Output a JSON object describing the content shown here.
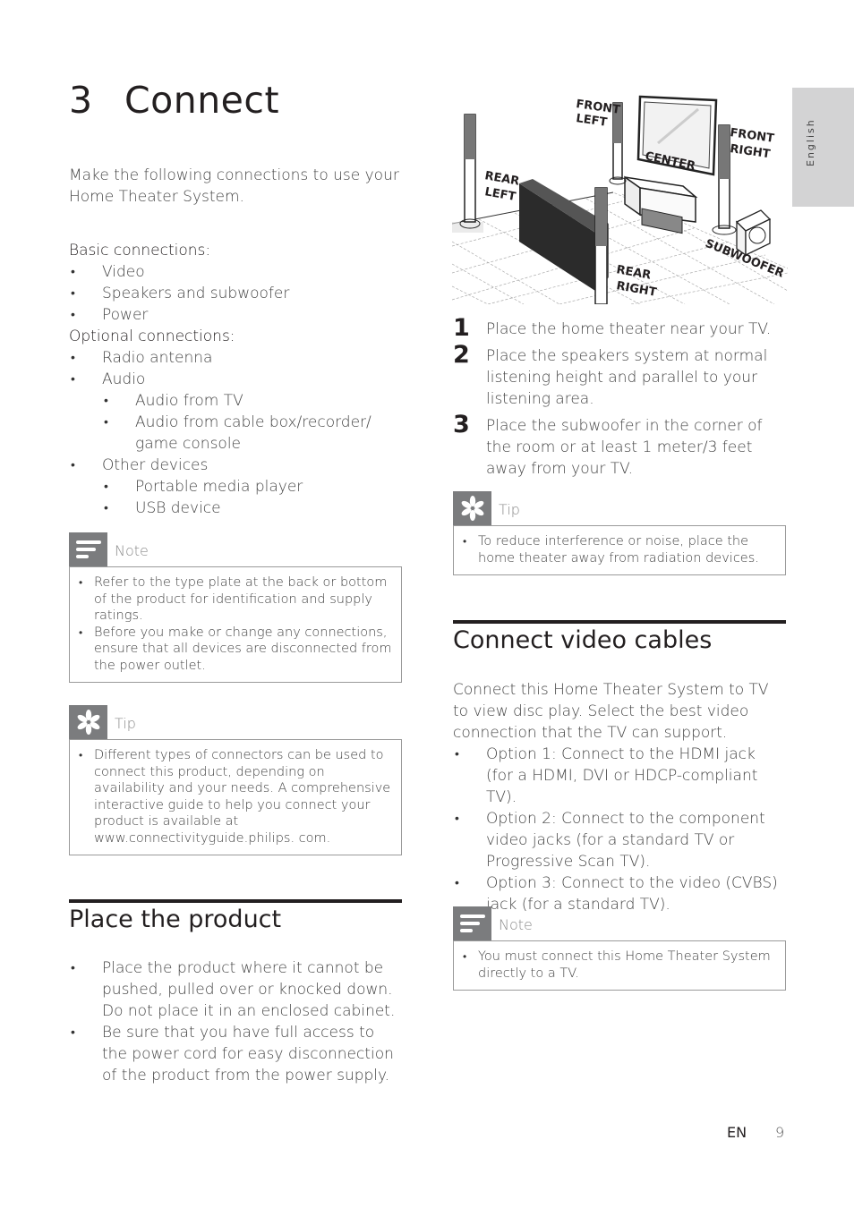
{
  "chapter": {
    "number": "3",
    "title": "Connect"
  },
  "intro": "Make the following connections to use your Home Theater System.",
  "connections": {
    "basic_label": "Basic connections:",
    "basic_items": [
      "Video",
      "Speakers and subwoofer",
      "Power"
    ],
    "optional_label": "Optional connections:",
    "optional_items": [
      {
        "label": "Radio antenna",
        "children": []
      },
      {
        "label": "Audio",
        "children": [
          "Audio from TV",
          "Audio from cable box/recorder/ game console"
        ]
      },
      {
        "label": "Other devices",
        "children": [
          "Portable media player",
          "USB device"
        ]
      }
    ]
  },
  "note1": {
    "icon": "note-lines-icon",
    "title": "Note",
    "items": [
      "Refer to the type plate at the back or bottom of the product for identification and supply ratings.",
      "Before you make or change any connections, ensure that all devices are disconnected from the power outlet."
    ]
  },
  "tip1": {
    "icon": "tip-asterisk-icon",
    "title": "Tip",
    "items": [
      "Different types of connectors can be used to connect this product, depending on availability and your needs. A comprehensive interactive guide to help you connect your product is available at www.connectivityguide.philips. com."
    ]
  },
  "place_product": {
    "heading": "Place the product",
    "items": [
      "Place the product where it cannot be pushed, pulled over or knocked down. Do not place it in an enclosed cabinet.",
      "Be sure that you have full access to the power cord for easy disconnection of the product from the power supply."
    ]
  },
  "illustration": {
    "labels": {
      "front_left": [
        "FRONT",
        "LEFT"
      ],
      "front_right": [
        "FRONT",
        "RIGHT"
      ],
      "center": "CENTER",
      "rear_left": [
        "REAR",
        "LEFT"
      ],
      "rear_right": [
        "REAR",
        "RIGHT"
      ],
      "subwoofer": "SUBWOOFER"
    }
  },
  "steps": [
    {
      "num": "1",
      "text": "Place the home theater near your TV."
    },
    {
      "num": "2",
      "text": "Place the speakers system at normal listening height and parallel to your listening area."
    },
    {
      "num": "3",
      "text": "Place the subwoofer in the corner of the room or at least 1 meter/3 feet away from your TV."
    }
  ],
  "tip2": {
    "icon": "tip-asterisk-icon",
    "title": "Tip",
    "items": [
      "To reduce interference or noise, place the home theater away from radiation devices."
    ]
  },
  "video_cables": {
    "heading": "Connect video cables",
    "intro": "Connect this Home Theater System to TV to view disc play. Select the best video connection that the TV can support.",
    "options": [
      "Option 1: Connect to the HDMI jack (for a HDMI, DVI or HDCP-compliant TV).",
      "Option 2: Connect to the component video jacks (for a standard TV or Progressive Scan TV).",
      "Option 3: Connect to the video (CVBS) jack (for a standard TV)."
    ]
  },
  "note2": {
    "icon": "note-lines-icon",
    "title": "Note",
    "items": [
      "You must connect this Home Theater System directly to a TV."
    ]
  },
  "side_tab": {
    "label": "English"
  },
  "footer": {
    "lang": "EN",
    "page": "9"
  },
  "colors": {
    "heading": "#231f20",
    "callout_icon_bg": "#7b7c7e",
    "side_tab_bg": "#d3d3d4"
  }
}
